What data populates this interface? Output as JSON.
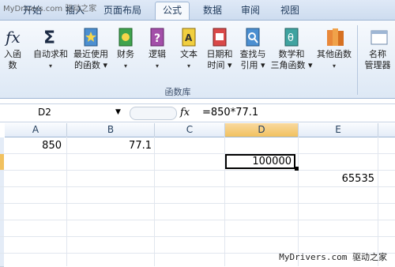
{
  "tabs": [
    {
      "label": "开始"
    },
    {
      "label": "插入"
    },
    {
      "label": "页面布局"
    },
    {
      "label": "公式"
    },
    {
      "label": "数据"
    },
    {
      "label": "审阅"
    },
    {
      "label": "视图"
    }
  ],
  "watermark_top": "MyDrivers.com 驱动之家",
  "ribbon": {
    "group_label": "函数库",
    "buttons": [
      {
        "label": "入函数",
        "label2": "",
        "icon": "fx-icon"
      },
      {
        "label": "自动求和",
        "label2": "▾",
        "icon": "sigma-icon"
      },
      {
        "label": "最近使用",
        "label2": "的函数 ▾",
        "icon": "star-book-icon"
      },
      {
        "label": "财务",
        "label2": "▾",
        "icon": "money-book-icon"
      },
      {
        "label": "逻辑",
        "label2": "▾",
        "icon": "question-book-icon"
      },
      {
        "label": "文本",
        "label2": "▾",
        "icon": "text-book-icon"
      },
      {
        "label": "日期和",
        "label2": "时间 ▾",
        "icon": "calendar-book-icon"
      },
      {
        "label": "查找与",
        "label2": "引用 ▾",
        "icon": "magnifier-book-icon"
      },
      {
        "label": "数学和",
        "label2": "三角函数 ▾",
        "icon": "theta-book-icon"
      },
      {
        "label": "其他函数",
        "label2": "▾",
        "icon": "books-icon"
      },
      {
        "label": "名称",
        "label2": "管理器",
        "icon": "name-manager-icon"
      }
    ]
  },
  "formula_bar": {
    "name_box": "D2",
    "fx": "fx",
    "formula": "=850*77.1"
  },
  "sheet": {
    "columns": [
      "A",
      "B",
      "C",
      "D",
      "E"
    ],
    "cells": {
      "A2": "850",
      "B2": "77.1",
      "D3": "100000",
      "E4": "65535"
    }
  },
  "footer": "MyDrivers.com 驱动之家",
  "colors": {
    "accent": "#f1c15f",
    "ribbon": "#dde8f5",
    "tab_text": "#1e395b"
  }
}
